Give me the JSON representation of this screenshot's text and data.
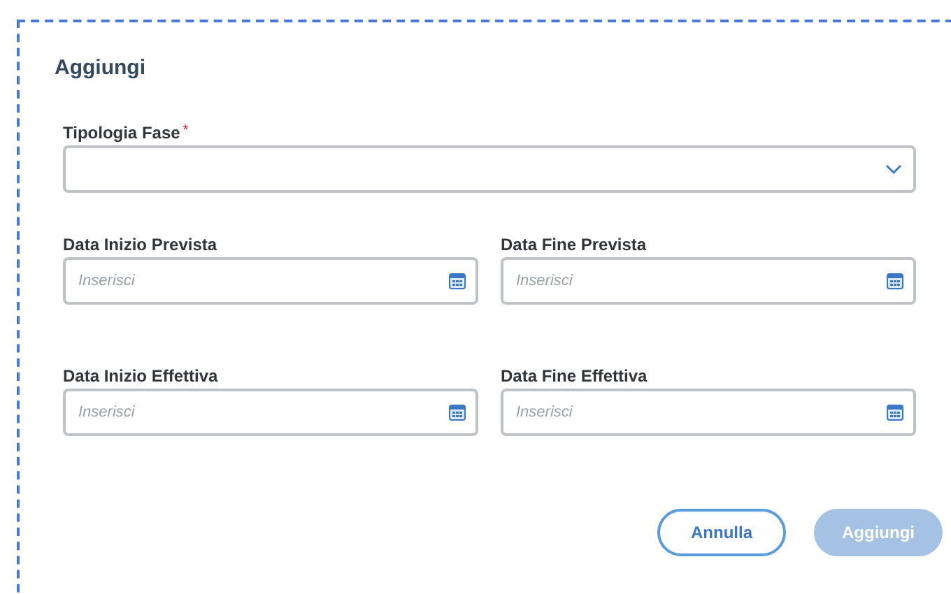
{
  "dialog": {
    "title": "Aggiungi"
  },
  "fields": [
    {
      "kind": "select",
      "label": "Tipologia Fase",
      "required_mark": "*"
    },
    {
      "kind": "date",
      "label": "Data Inizio Prevista",
      "placeholder": "Inserisci"
    },
    {
      "kind": "date",
      "label": "Data Fine Prevista",
      "placeholder": "Inserisci"
    },
    {
      "kind": "date",
      "label": "Data Inizio Effettiva",
      "placeholder": "Inserisci"
    },
    {
      "kind": "date",
      "label": "Data Fine Effettiva",
      "placeholder": "Inserisci"
    }
  ],
  "buttons": [
    {
      "label": "Annulla",
      "kind": "secondary",
      "disabled": false
    },
    {
      "label": "Aggiungi",
      "kind": "primary",
      "disabled": true
    }
  ]
}
